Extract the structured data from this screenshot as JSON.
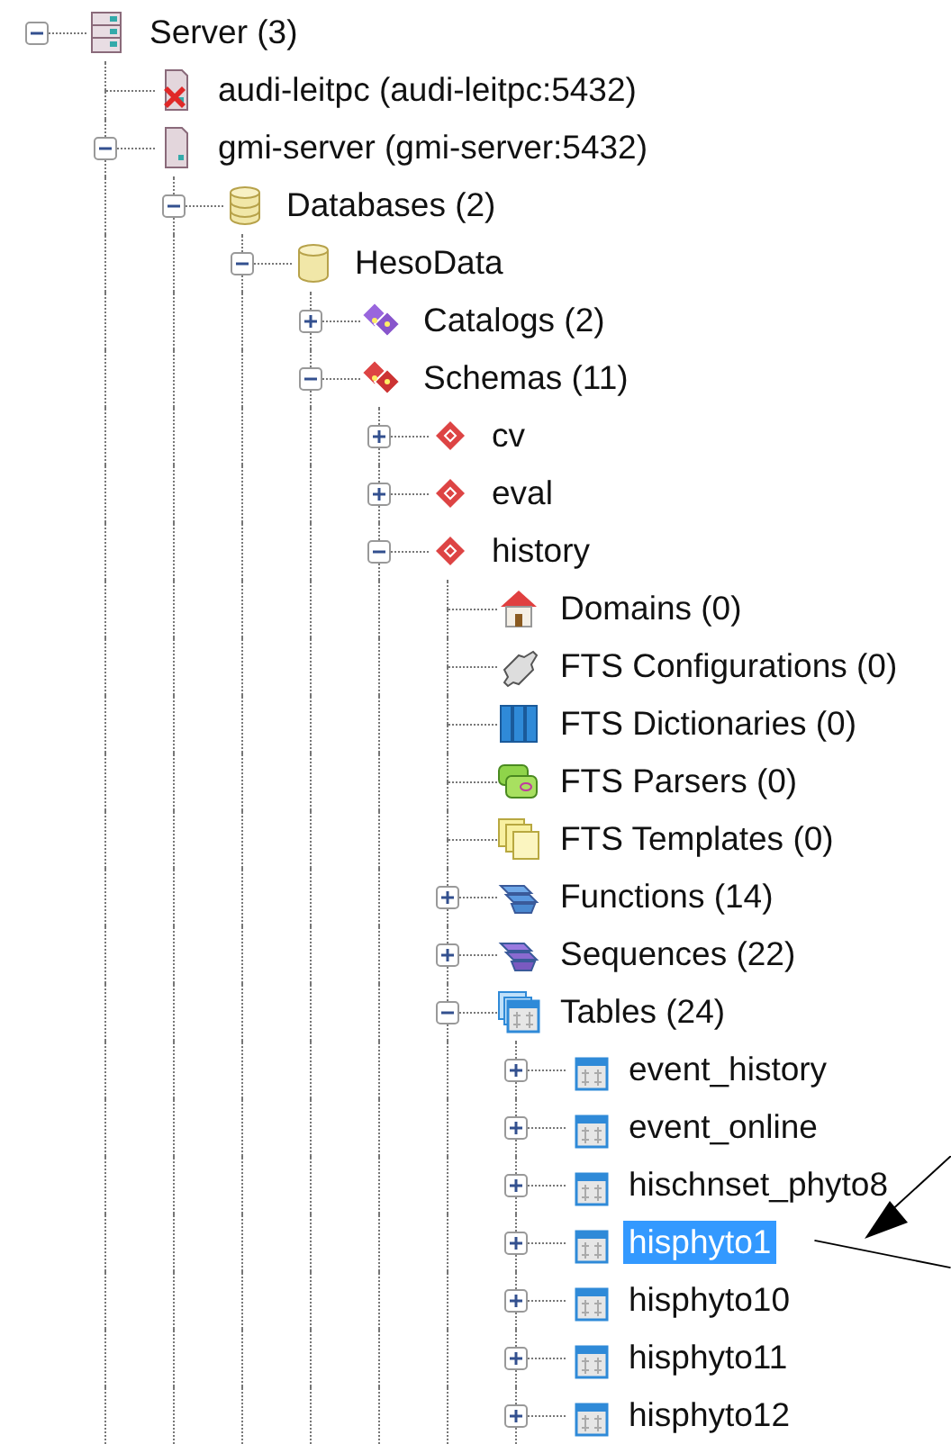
{
  "tree": [
    {
      "label": "Server (3)",
      "kind": "server-group",
      "expanded": true,
      "selected": false,
      "children": [
        {
          "label": "audi-leitpc (audi-leitpc:5432)",
          "kind": "server-down",
          "selected": false
        },
        {
          "label": "gmi-server (gmi-server:5432)",
          "kind": "server",
          "expanded": true,
          "selected": false,
          "children": [
            {
              "label": "Databases (2)",
              "kind": "databases",
              "expanded": true,
              "selected": false,
              "children": [
                {
                  "label": "HesoData",
                  "kind": "database",
                  "expanded": true,
                  "selected": false,
                  "children": [
                    {
                      "label": "Catalogs (2)",
                      "kind": "catalogs",
                      "expanded": false,
                      "selected": false
                    },
                    {
                      "label": "Schemas (11)",
                      "kind": "schemas",
                      "expanded": true,
                      "selected": false,
                      "children": [
                        {
                          "label": "cv",
                          "kind": "schema",
                          "expanded": false,
                          "selected": false
                        },
                        {
                          "label": "eval",
                          "kind": "schema",
                          "expanded": false,
                          "selected": false
                        },
                        {
                          "label": "history",
                          "kind": "schema",
                          "expanded": true,
                          "selected": false,
                          "children": [
                            {
                              "label": "Domains (0)",
                              "kind": "domains",
                              "selected": false
                            },
                            {
                              "label": "FTS Configurations (0)",
                              "kind": "fts-config",
                              "selected": false
                            },
                            {
                              "label": "FTS Dictionaries (0)",
                              "kind": "fts-dict",
                              "selected": false
                            },
                            {
                              "label": "FTS Parsers (0)",
                              "kind": "fts-parser",
                              "selected": false
                            },
                            {
                              "label": "FTS Templates (0)",
                              "kind": "fts-template",
                              "selected": false
                            },
                            {
                              "label": "Functions (14)",
                              "kind": "functions",
                              "expanded": false,
                              "selected": false
                            },
                            {
                              "label": "Sequences (22)",
                              "kind": "sequences",
                              "expanded": false,
                              "selected": false
                            },
                            {
                              "label": "Tables (24)",
                              "kind": "tables",
                              "expanded": true,
                              "selected": false,
                              "children": [
                                {
                                  "label": "event_history",
                                  "kind": "table",
                                  "expanded": false,
                                  "selected": false
                                },
                                {
                                  "label": "event_online",
                                  "kind": "table",
                                  "expanded": false,
                                  "selected": false
                                },
                                {
                                  "label": "hischnset_phyto8",
                                  "kind": "table",
                                  "expanded": false,
                                  "selected": false
                                },
                                {
                                  "label": "hisphyto1",
                                  "kind": "table",
                                  "expanded": false,
                                  "selected": true
                                },
                                {
                                  "label": "hisphyto10",
                                  "kind": "table",
                                  "expanded": false,
                                  "selected": false
                                },
                                {
                                  "label": "hisphyto11",
                                  "kind": "table",
                                  "expanded": false,
                                  "selected": false
                                },
                                {
                                  "label": "hisphyto12",
                                  "kind": "table",
                                  "expanded": false,
                                  "selected": false
                                }
                              ]
                            }
                          ]
                        }
                      ]
                    }
                  ]
                }
              ]
            }
          ]
        }
      ]
    }
  ]
}
